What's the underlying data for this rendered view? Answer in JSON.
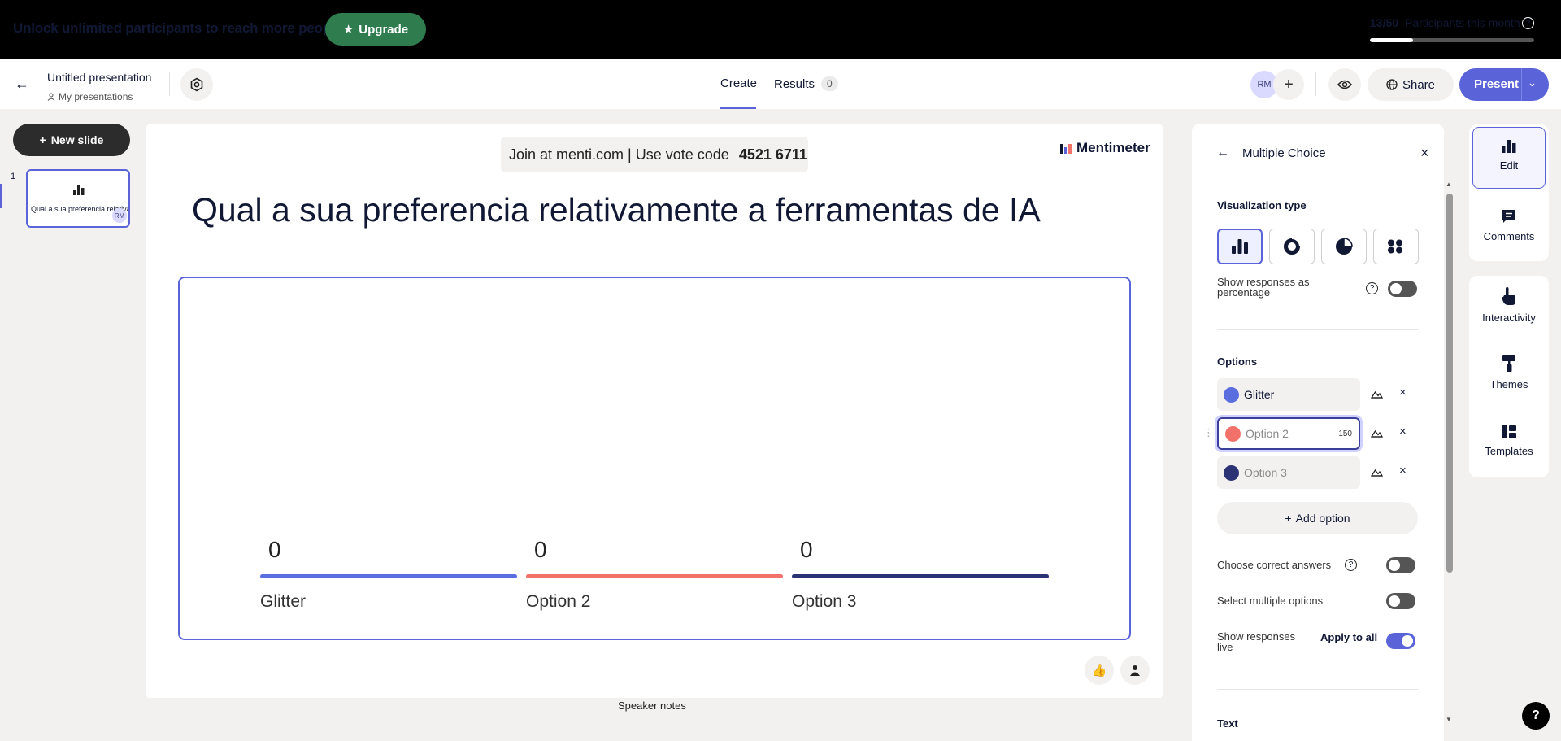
{
  "banner": {
    "text": "Unlock unlimited participants to reach more people.",
    "upgrade_label": "Upgrade",
    "participants_count": "13/50",
    "participants_label": "Participants this month",
    "participants_fraction": 0.26
  },
  "header": {
    "title": "Untitled presentation",
    "breadcrumb": "My presentations",
    "tabs": [
      {
        "label": "Create",
        "active": true
      },
      {
        "label": "Results",
        "badge": "0",
        "active": false
      }
    ],
    "avatar_initials": "RM",
    "share_label": "Share",
    "present_label": "Present"
  },
  "sidebar": {
    "new_slide_label": "New slide",
    "slides": [
      {
        "number": "1",
        "title": "Qual a sua preferencia relativamente a ferramentas de IA",
        "avatar": "RM"
      }
    ]
  },
  "slide": {
    "join_text": "Join at menti.com | Use vote code",
    "vote_code": "4521 6711",
    "brand": "Mentimeter",
    "question": "Qual a sua preferencia relativamente a ferramentas de IA",
    "speaker_notes_label": "Speaker notes"
  },
  "chart_data": {
    "type": "bar",
    "categories": [
      "Glitter",
      "Option 2",
      "Option 3"
    ],
    "values": [
      0,
      0,
      0
    ],
    "colors": [
      "#5a6ee0",
      "#f2726b",
      "#2b3375"
    ]
  },
  "edit_panel": {
    "title": "Multiple Choice",
    "visualization_label": "Visualization type",
    "visualization_types": [
      "bar-chart-icon",
      "donut-chart-icon",
      "pie-chart-icon",
      "dots-icon"
    ],
    "show_pct_label": "Show responses as percentage",
    "options_label": "Options",
    "options": [
      {
        "value": "Glitter",
        "placeholder": "",
        "color": "#5a6ee0"
      },
      {
        "value": "",
        "placeholder": "Option 2",
        "color": "#f2726b",
        "char_limit": "150"
      },
      {
        "value": "",
        "placeholder": "Option 3",
        "color": "#2b3375"
      }
    ],
    "add_option_label": "Add option",
    "choose_correct_label": "Choose correct answers",
    "select_multiple_label": "Select multiple options",
    "show_live_label": "Show responses live",
    "apply_all_label": "Apply to all",
    "text_section_label": "Text",
    "toggles": {
      "show_pct": false,
      "choose_correct": false,
      "select_multiple": false,
      "show_live": true
    }
  },
  "rail": {
    "items": [
      {
        "label": "Edit",
        "icon": "edit-chart-icon"
      },
      {
        "label": "Comments",
        "icon": "comment-icon"
      },
      {
        "label": "Interactivity",
        "icon": "hand-pointer-icon"
      },
      {
        "label": "Themes",
        "icon": "paint-roller-icon"
      },
      {
        "label": "Templates",
        "icon": "templates-icon"
      }
    ]
  },
  "help_label": "?"
}
